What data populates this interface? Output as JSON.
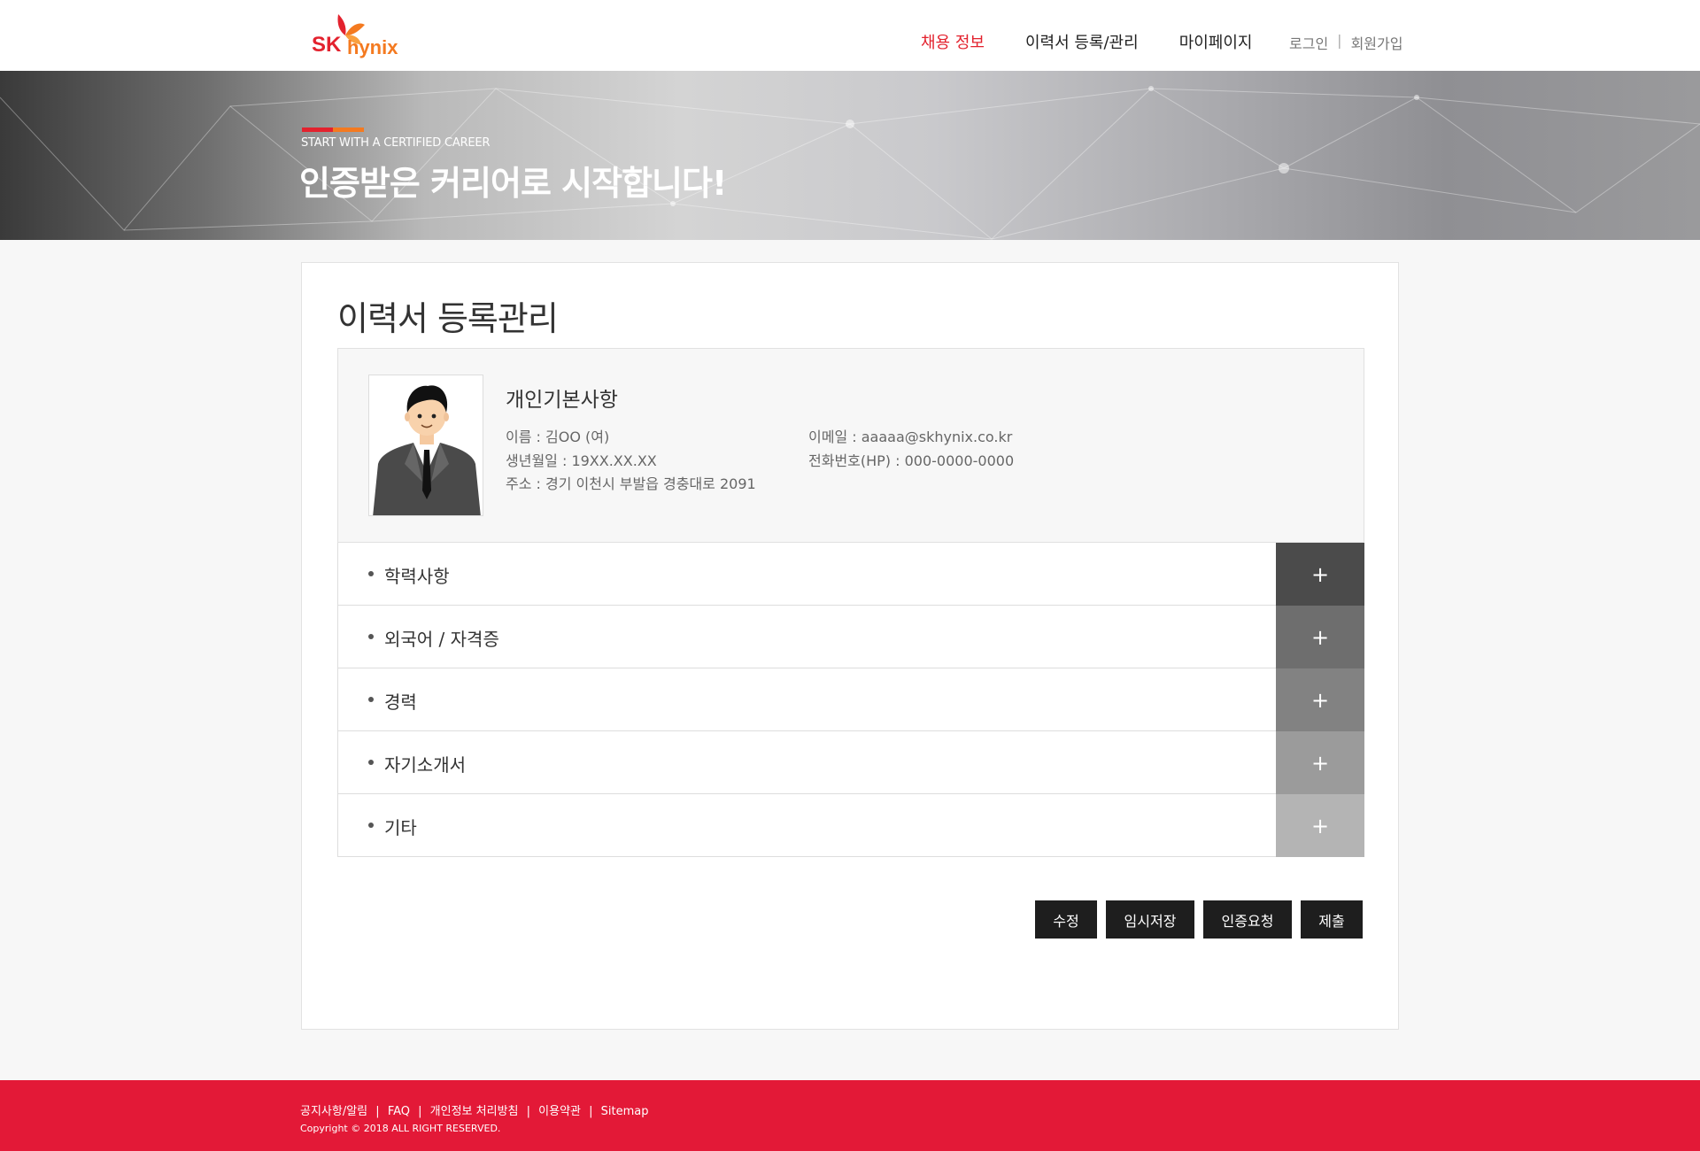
{
  "brand": {
    "name": "SK hynix",
    "sk": "SK",
    "hynix": "hynix",
    "red": "#e3222e",
    "orange": "#f47a20"
  },
  "nav": {
    "items": [
      {
        "label": "채용 정보",
        "active": true
      },
      {
        "label": "이력서 등록/관리",
        "active": false
      },
      {
        "label": "마이페이지",
        "active": false
      }
    ],
    "login": "로그인",
    "signup": "회원가입",
    "separator": "|"
  },
  "banner": {
    "subtitle": "START WITH A CERTIFIED CAREER",
    "title": "인증받은 커리어로 시작합니다!"
  },
  "page": {
    "title": "이력서 등록관리"
  },
  "profile": {
    "heading": "개인기본사항",
    "name": "이름  : 김OO (여)",
    "birth": "생년월일 : 19XX.XX.XX",
    "address": "주소 : 경기 이천시 부발읍 경충대로 2091",
    "email": "이메일 : aaaaa@skhynix.co.kr",
    "phone": "전화번호(HP) : 000-0000-0000"
  },
  "sections": [
    {
      "label": "학력사항",
      "icon": "+",
      "color": "#4b4b4b"
    },
    {
      "label": "외국어 / 자격증",
      "icon": "+",
      "color": "#6e6e6e"
    },
    {
      "label": "경력",
      "icon": "+",
      "color": "#828282"
    },
    {
      "label": "자기소개서",
      "icon": "+",
      "color": "#9b9b9b"
    },
    {
      "label": "기타",
      "icon": "+",
      "color": "#b4b4b4"
    }
  ],
  "actions": {
    "edit": "수정",
    "temp_save": "임시저장",
    "cert_request": "인증요청",
    "submit": "제출"
  },
  "footer": {
    "links": [
      "공지사항/알림",
      "FAQ",
      "개인정보 처리방침",
      "이용약관",
      "Sitemap"
    ],
    "separator": "|",
    "copyright": "Copyright © 2018  ALL RIGHT RESERVED."
  }
}
